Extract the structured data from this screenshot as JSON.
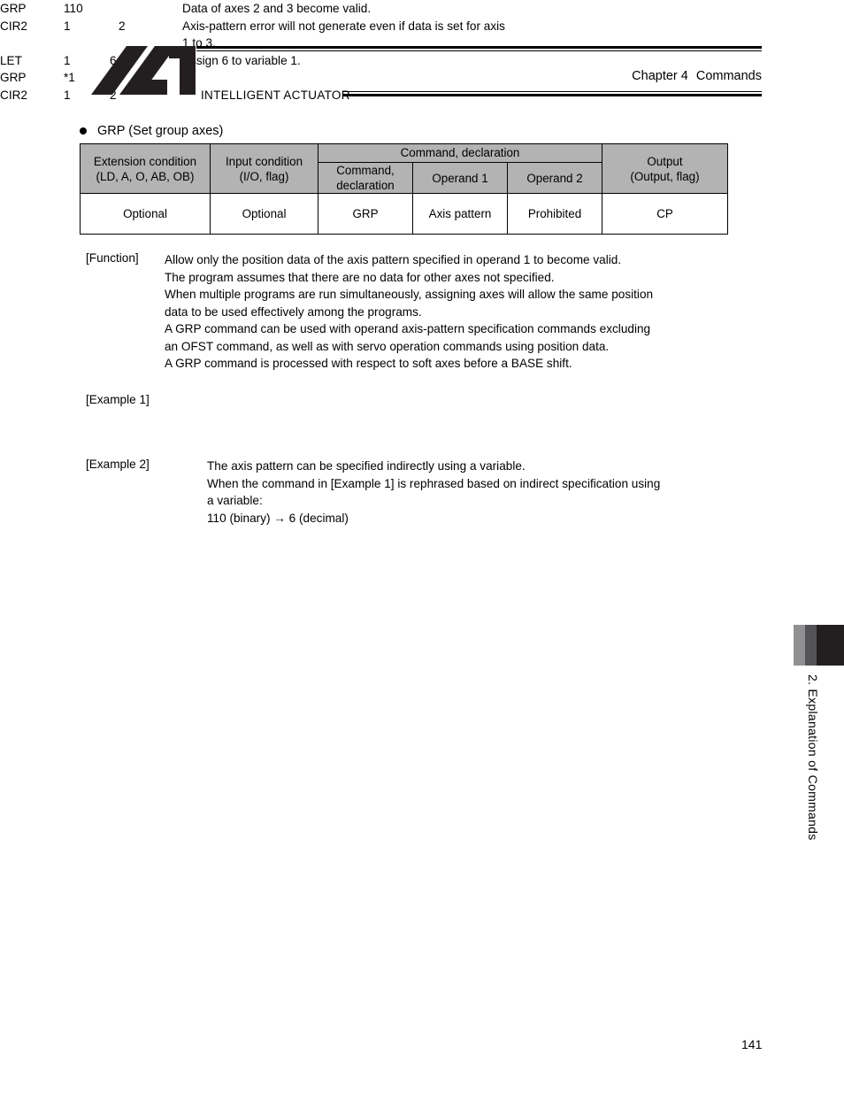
{
  "header": {
    "brand": "INTELLIGENT ACTUATOR",
    "chapter": "Chapter 4",
    "chapter_section": "Commands",
    "logo_icon": "ia-logo-icon"
  },
  "section": {
    "bullet_icon": "bullet-dot-icon",
    "title": "GRP (Set group axes)"
  },
  "spec_table": {
    "group_header": "Command, declaration",
    "headers": {
      "extension_condition": "Extension condition\n(LD, A, O, AB, OB)",
      "extension_condition_line1": "Extension condition",
      "extension_condition_line2": "(LD, A, O, AB, OB)",
      "input_condition_line1": "Input condition",
      "input_condition_line2": "(I/O, flag)",
      "command_declaration_line1": "Command,",
      "command_declaration_line2": "declaration",
      "operand1": "Operand 1",
      "operand2": "Operand 2",
      "output_line1": "Output",
      "output_line2": "(Output, flag)"
    },
    "row": {
      "extension_condition": "Optional",
      "input_condition": "Optional",
      "command_declaration": "GRP",
      "operand1": "Axis pattern",
      "operand2": "Prohibited",
      "output": "CP"
    }
  },
  "function": {
    "tag": "[Function]",
    "lines": [
      "Allow only the position data of the axis pattern specified in operand 1 to become valid.",
      "The program assumes that there are no data for other axes not specified.",
      "When multiple programs are run simultaneously, assigning axes will allow the same position",
      "data to be used effectively among the programs.",
      "A GRP command can be used with operand axis-pattern specification commands excluding",
      "an OFST command, as well as with servo operation commands using position data.",
      "A GRP command is processed with respect to soft axes before a BASE shift."
    ]
  },
  "example1": {
    "tag": "[Example 1]",
    "rows": [
      {
        "mnemonic": "GRP",
        "operand1": "110",
        "operand2": "",
        "note": "Data of axes 2 and 3 become valid."
      },
      {
        "mnemonic": "CIR2",
        "operand1": "1",
        "operand2": "2",
        "note": "Axis-pattern error will not generate even if data is set for axis"
      }
    ],
    "note_continuation": "1 to 3."
  },
  "example2": {
    "tag": "[Example 2]",
    "lines": [
      "The axis pattern can be specified indirectly using a variable.",
      "When the command in [Example 1] is rephrased based on indirect specification using",
      "a variable:",
      "110 (binary) → 6 (decimal)"
    ],
    "rows": [
      {
        "mnemonic": "LET",
        "operand1": "1",
        "operand2": "6",
        "note": "Assign 6 to variable 1."
      },
      {
        "mnemonic": "GRP",
        "operand1": "*1",
        "operand2": "",
        "note": ""
      },
      {
        "mnemonic": "CIR2",
        "operand1": "1",
        "operand2": "2",
        "note": ""
      }
    ]
  },
  "side_tab": {
    "label": "2. Explanation of Commands",
    "band_colors": [
      "#908f92",
      "#545356",
      "#231f20"
    ]
  },
  "footer": {
    "page_number": "141"
  }
}
